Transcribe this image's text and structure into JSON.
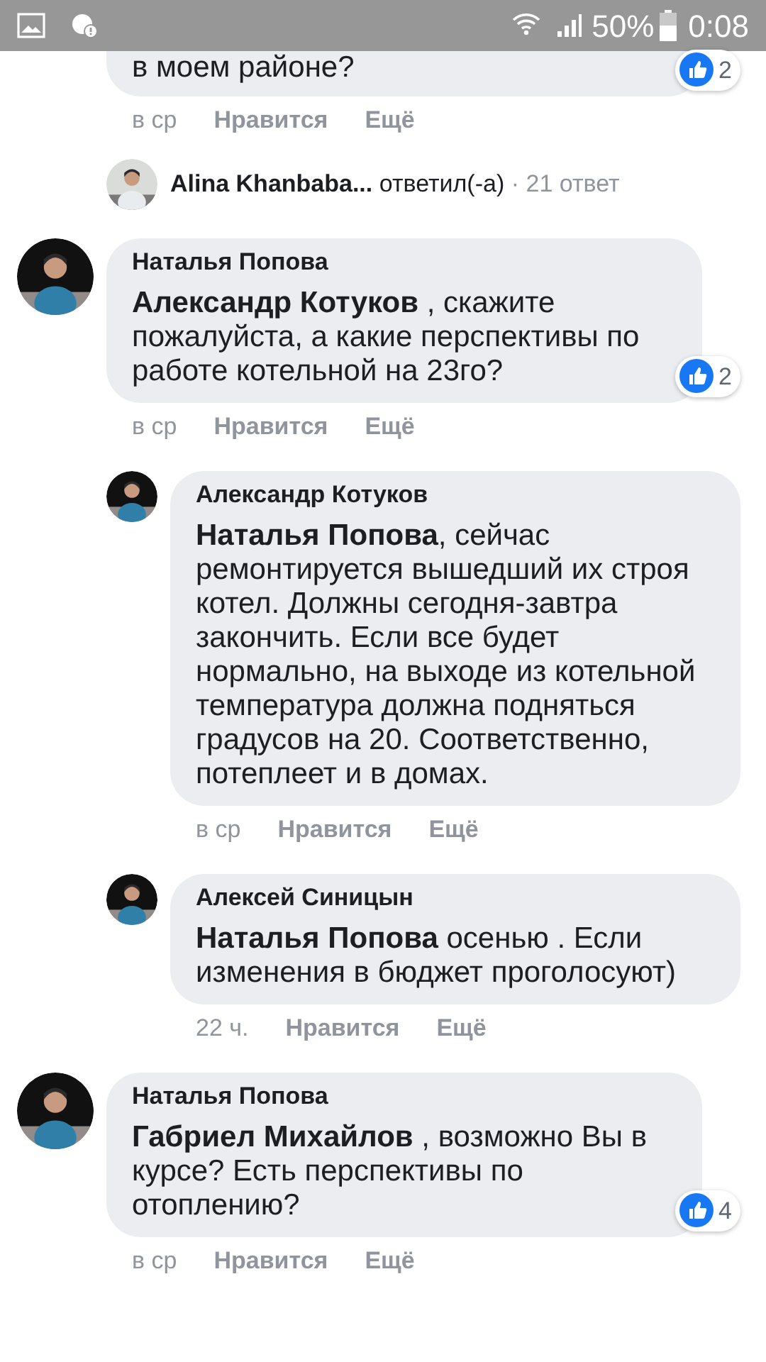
{
  "status_bar": {
    "battery": "50%",
    "time": "0:08"
  },
  "comments": [
    {
      "text": "в моем районе?",
      "reactions": "2",
      "time": "в ср",
      "like": "Нравится",
      "more": "Ещё",
      "reply_summary": {
        "author": "Alina Khanbaba...",
        "action": "ответил(-а)",
        "count": "· 21 ответ"
      }
    },
    {
      "author": "Наталья Попова",
      "text": "**Александр Котуков** , скажите пожалуйста, а какие перспективы по работе котельной на 23го?",
      "reactions": "2",
      "time": "в ср",
      "like": "Нравится",
      "more": "Ещё",
      "children": [
        {
          "author": "Александр Котуков",
          "text": "**Наталья Попова**, сейчас ремонтируется вышедший их строя котел. Должны сегодня-завтра закончить. Если все будет нормально, на выходе из котельной температура должна подняться градусов на 20. Соответственно, потеплеет и в домах.",
          "time": "в ср",
          "like": "Нравится",
          "more": "Ещё"
        },
        {
          "author": "Алексей Синицын",
          "text": "**Наталья Попова** осенью . Если изменения в бюджет проголосуют)",
          "time": "22 ч.",
          "like": "Нравится",
          "more": "Ещё"
        }
      ]
    },
    {
      "author": "Наталья Попова",
      "text": "**Габриел Михайлов** , возможно Вы в курсе? Есть перспективы по отоплению?",
      "reactions": "4",
      "time": "в ср",
      "like": "Нравится",
      "more": "Ещё"
    }
  ]
}
